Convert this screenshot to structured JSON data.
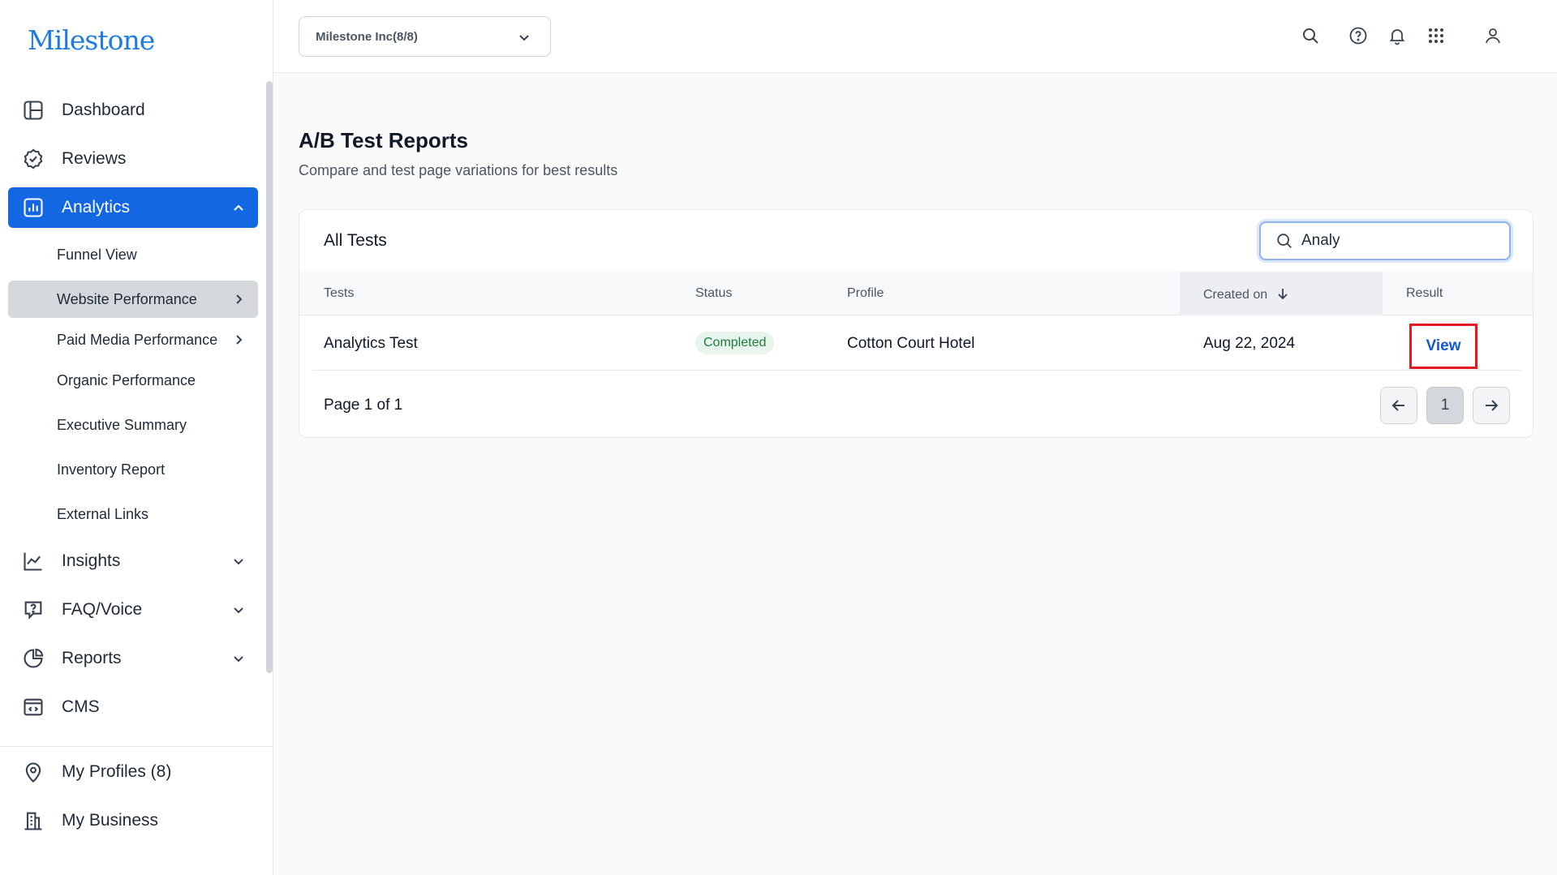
{
  "brand": {
    "logo": "Milestone",
    "color": "#1e7be0"
  },
  "sidebar": {
    "items": [
      {
        "label": "Dashboard",
        "icon": "layout-icon"
      },
      {
        "label": "Reviews",
        "icon": "badge-check-icon"
      },
      {
        "label": "Analytics",
        "icon": "bar-chart-icon",
        "expanded": true
      },
      {
        "label": "Insights",
        "icon": "line-chart-icon"
      },
      {
        "label": "FAQ/Voice",
        "icon": "message-question-icon"
      },
      {
        "label": "Reports",
        "icon": "pie-chart-icon"
      },
      {
        "label": "CMS",
        "icon": "code-browser-icon"
      }
    ],
    "analytics_sub": [
      {
        "label": "Funnel View"
      },
      {
        "label": "Website Performance",
        "selected": true
      },
      {
        "label": "Paid Media Performance"
      },
      {
        "label": "Organic Performance"
      },
      {
        "label": "Executive Summary"
      },
      {
        "label": "Inventory Report"
      },
      {
        "label": "External Links"
      }
    ],
    "bottom": [
      {
        "label": "My Profiles (8)",
        "icon": "map-pin-icon"
      },
      {
        "label": "My Business",
        "icon": "building-icon"
      }
    ]
  },
  "header": {
    "org_select": "Milestone Inc(8/8)",
    "icons": [
      "search-icon",
      "help-icon",
      "bell-icon",
      "apps-grid-icon",
      "user-icon"
    ]
  },
  "main": {
    "title": "A/B Test Reports",
    "subtitle": "Compare and test page variations for best results",
    "card": {
      "title": "All Tests",
      "search_value": "Analy",
      "columns": [
        "Tests",
        "Status",
        "Profile",
        "Created on",
        "Result"
      ],
      "rows": [
        {
          "test": "Analytics Test",
          "status": "Completed",
          "profile": "Cotton Court Hotel",
          "created": "Aug 22, 2024",
          "result": "View"
        }
      ],
      "pager": {
        "text": "Page 1 of 1",
        "current": "1"
      }
    }
  },
  "colors": {
    "accent": "#1367e3",
    "link": "#1558d6",
    "highlight": "#e21b23",
    "success": "#1f7a3e"
  }
}
